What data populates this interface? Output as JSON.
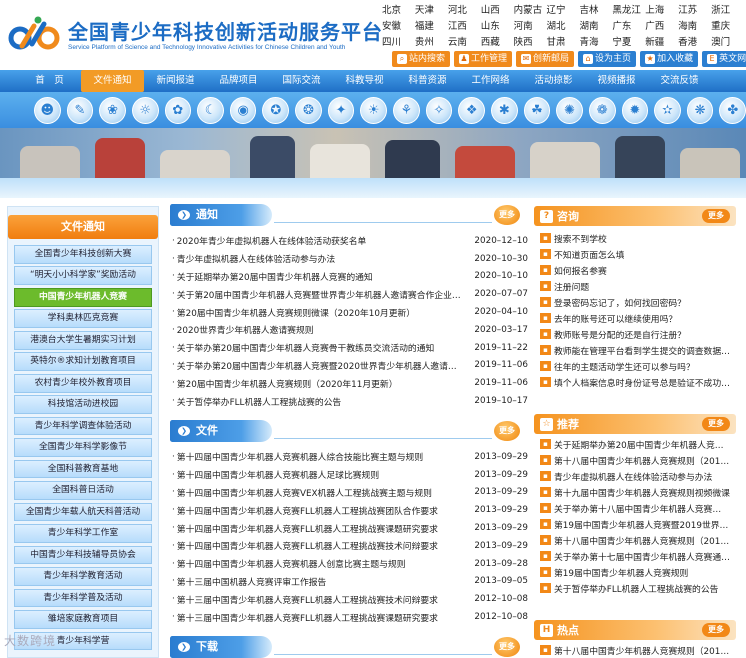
{
  "header": {
    "title": "全国青少年科技创新活动服务平台",
    "subtitle": "Service Platform of Science and Technology Innovative Activities for Chinese Children and Youth",
    "regions": [
      "北京",
      "天津",
      "河北",
      "山西",
      "内蒙古",
      "辽宁",
      "吉林",
      "黑龙江",
      "上海",
      "江苏",
      "浙江",
      "安徽",
      "福建",
      "江西",
      "山东",
      "河南",
      "湖北",
      "湖南",
      "广东",
      "广西",
      "海南",
      "重庆",
      "四川",
      "贵州",
      "云南",
      "西藏",
      "陕西",
      "甘肃",
      "青海",
      "宁夏",
      "新疆",
      "香港",
      "澳门"
    ],
    "links": [
      {
        "label": "站内搜索",
        "style": "orange",
        "icon": "search-icon",
        "glyph": "⌕"
      },
      {
        "label": "工作管理",
        "style": "orange",
        "icon": "person-icon",
        "glyph": "♟"
      },
      {
        "label": "创新邮局",
        "style": "orange",
        "icon": "mail-icon",
        "glyph": "✉"
      },
      {
        "label": "设为主页",
        "style": "blue",
        "icon": "home-icon",
        "glyph": "⌂"
      },
      {
        "label": "加入收藏",
        "style": "blue",
        "icon": "star-icon",
        "glyph": "★"
      },
      {
        "label": "英文网站",
        "style": "blue",
        "icon": "globe-icon",
        "glyph": "E"
      }
    ]
  },
  "nav": [
    "首　页",
    "文件通知",
    "新闻报道",
    "品牌项目",
    "国际交流",
    "科教导视",
    "科普资源",
    "工作网络",
    "活动掠影",
    "视频播报",
    "交流反馈"
  ],
  "nav_active": 1,
  "sidebar": {
    "title": "文件通知",
    "items": [
      "全国青少年科技创新大赛",
      "“明天小小科学家”奖励活动",
      "中国青少年机器人竞赛",
      "学科奥林匹克竞赛",
      "港澳台大学生暑期实习计划",
      "英特尔®求知计划教育项目",
      "农村青少年校外教育项目",
      "科技馆活动进校园",
      "青少年科学调查体验活动",
      "全国青少年科学影像节",
      "全国科普教育基地",
      "全国科普日活动",
      "全国青少年载人航天科普活动",
      "青少年科学工作室",
      "中国青少年科技辅导员协会",
      "青少年科学教育活动",
      "青少年科学普及活动",
      "雏培家庭教育项目",
      "青少年科学营"
    ],
    "active": 2
  },
  "notices": {
    "title": "通知",
    "more": "更多",
    "rows": [
      {
        "t": "2020年青少年虚拟机器人在线体验活动获奖名单",
        "d": "2020–12–10"
      },
      {
        "t": "青少年虚拟机器人在线体验活动参与办法",
        "d": "2020–10–30"
      },
      {
        "t": "关于延期举办第20届中国青少年机器人竞赛的通知",
        "d": "2020–10–10"
      },
      {
        "t": "关于第20届中国青少年机器人竞赛暨世界青少年机器人邀请赛合作企业…",
        "d": "2020–07–07"
      },
      {
        "t": "第20届中国青少年机器人竞赛规则微课（2020年10月更新）",
        "d": "2020–04–10"
      },
      {
        "t": "2020世界青少年机器人邀请赛规则",
        "d": "2020–03–17"
      },
      {
        "t": "关于举办第20届中国青少年机器人竞赛骨干教练员交流活动的通知",
        "d": "2019–11–22"
      },
      {
        "t": "关于举办第20届中国青少年机器人竞赛暨2020世界青少年机器人邀请赛…",
        "d": "2019–11–06"
      },
      {
        "t": "第20届中国青少年机器人竞赛规则（2020年11月更新）",
        "d": "2019–11–06"
      },
      {
        "t": "关于暂停举办FLL机器人工程挑战赛的公告",
        "d": "2019–10–17"
      }
    ]
  },
  "files": {
    "title": "文件",
    "more": "更多",
    "rows": [
      {
        "t": "第十四届中国青少年机器人竞赛机器人综合技能比赛主题与规则",
        "d": "2013–09–29"
      },
      {
        "t": "第十四届中国青少年机器人竞赛机器人足球比赛规则",
        "d": "2013–09–29"
      },
      {
        "t": "第十四届中国青少年机器人竞赛VEX机器人工程挑战赛主题与规则",
        "d": "2013–09–29"
      },
      {
        "t": "第十四届中国青少年机器人竞赛FLL机器人工程挑战赛团队合作要求",
        "d": "2013–09–29"
      },
      {
        "t": "第十四届中国青少年机器人竞赛FLL机器人工程挑战赛课题研究要求",
        "d": "2013–09–29"
      },
      {
        "t": "第十四届中国青少年机器人竞赛FLL机器人工程挑战赛技术问辩要求",
        "d": "2013–09–29"
      },
      {
        "t": "第十四届中国青少年机器人竞赛机器人创意比赛主题与规则",
        "d": "2013–09–28"
      },
      {
        "t": "第十三届中国机器人竞赛评审工作报告",
        "d": "2013–09–05"
      },
      {
        "t": "第十三届中国青少年机器人竞赛FLL机器人工程挑战赛技术问辩要求",
        "d": "2012–10–08"
      },
      {
        "t": "第十三届中国青少年机器人竞赛FLL机器人工程挑战赛课题研究要求",
        "d": "2012–10–08"
      }
    ]
  },
  "downloads": {
    "title": "下载",
    "more": "更多"
  },
  "consult": {
    "title": "咨询",
    "more": "更多",
    "items": [
      "搜索不到学校",
      "不知道页面怎么填",
      "如何报名参赛",
      "注册问题",
      "登录密码忘记了，如何找回密码？",
      "去年的账号还可以继续使用吗？",
      "教师账号是分配的还是自行注册？",
      "教师能在管理平台看到学生提交的调查数据…",
      "往年的主题活动学生还可以参与吗？",
      "填个人档案信息时身份证号总是验证不成功…"
    ]
  },
  "recommend": {
    "title": "推荐",
    "more": "更多",
    "items": [
      "关于延期举办第20届中国青少年机器人竞…",
      "第十八届中国青少年机器人竞赛规则（201…",
      "青少年虚拟机器人在线体验活动参与办法",
      "第十九届中国青少年机器人竞赛规则视频微课",
      "关于举办第十八届中国青少年机器人竞赛…",
      "第19届中国青少年机器人竞赛暨2019世界…",
      "第十八届中国青少年机器人竞赛规则（201…",
      "关于举办第十七届中国青少年机器人竞赛通知…",
      "第19届中国青少年机器人竞赛规则",
      "关于暂停举办FLL机器人工程挑战赛的公告"
    ]
  },
  "hot": {
    "title": "热点",
    "more": "更多",
    "items": [
      "第十八届中国青少年机器人竞赛规则（201…"
    ]
  },
  "watermark": "大数跨境",
  "colors": {
    "brand": "#1c6cc4",
    "accent": "#f08a1c",
    "active_green": "#6cbb2c"
  }
}
